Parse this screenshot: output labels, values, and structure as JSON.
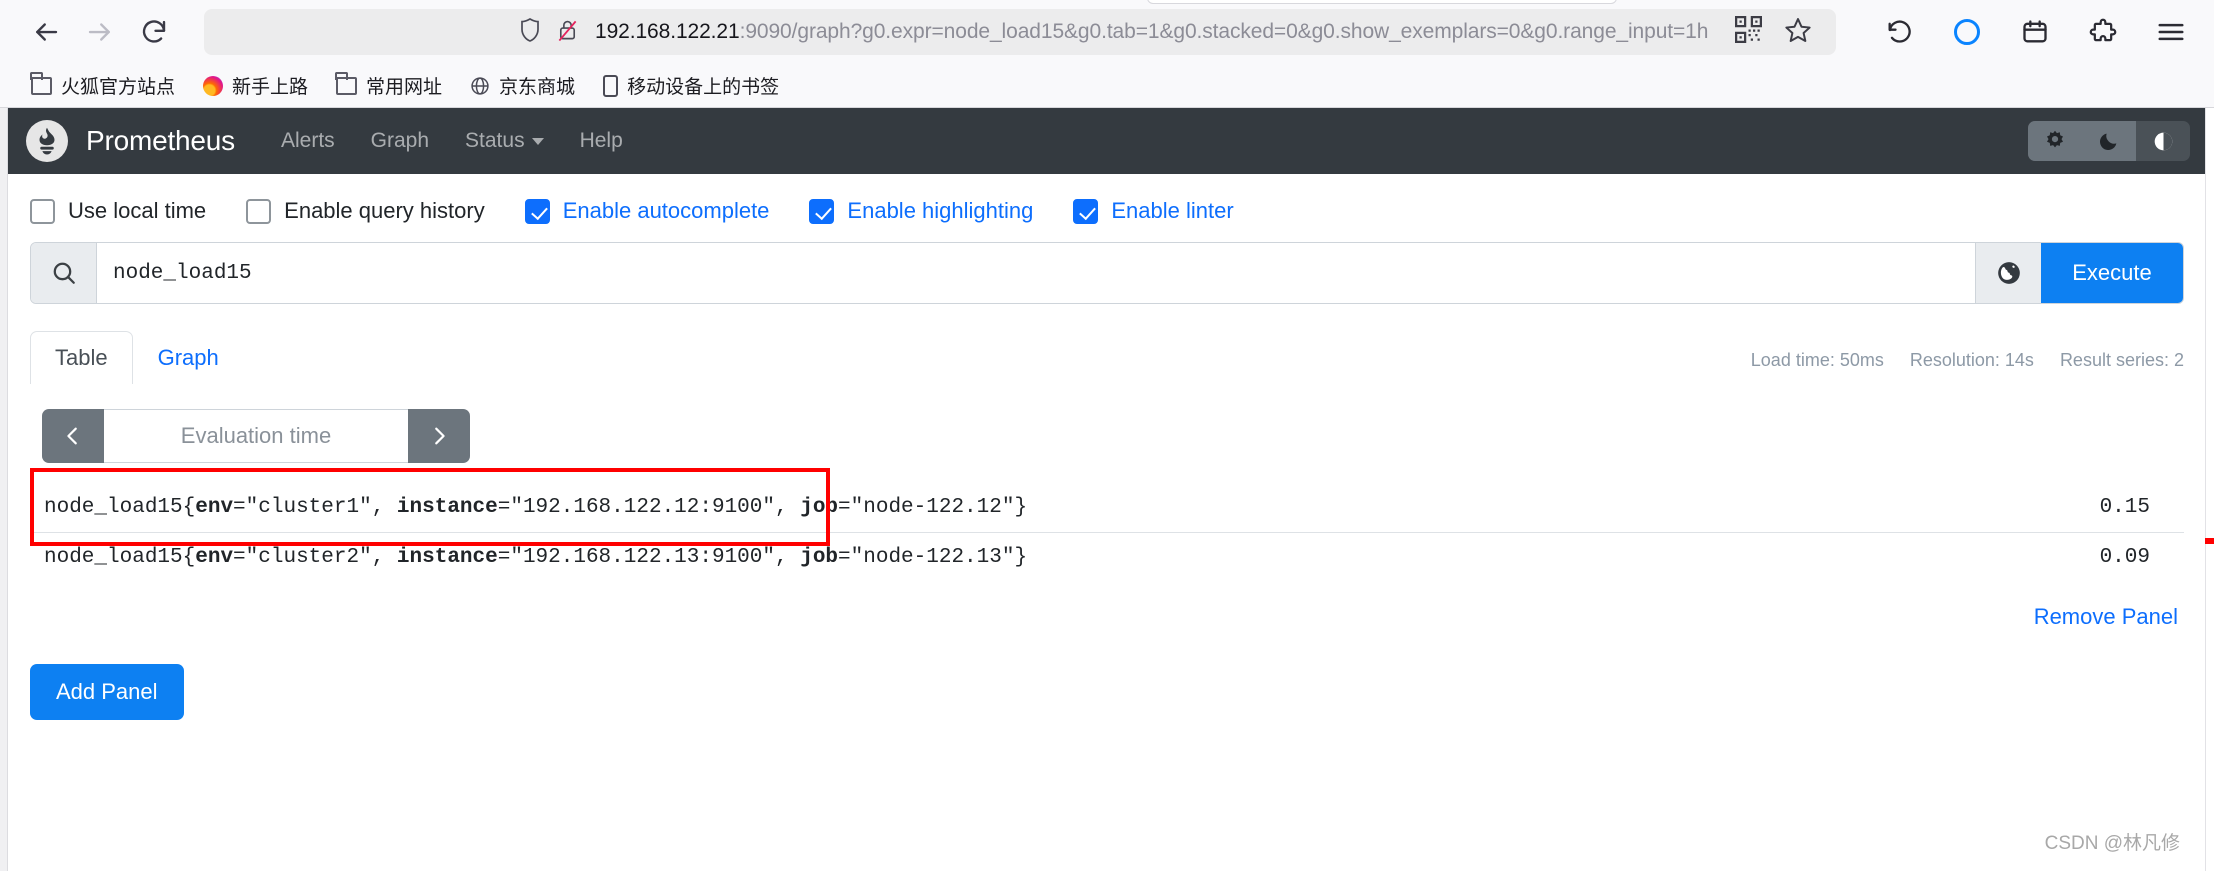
{
  "browser": {
    "back_icon": "back-arrow-icon",
    "forward_icon": "forward-arrow-icon",
    "reload_icon": "reload-icon",
    "shield_icon": "shield-icon",
    "no_permission_icon": "permission-blocked-icon",
    "url_host": "192.168.122.21",
    "url_rest": ":9090/graph?g0.expr=node_load15&g0.tab=1&g0.stacked=0&g0.show_exemplars=0&g0.range_input=1h",
    "qr_icon": "qr-code-icon",
    "bookmark_star_icon": "star-icon",
    "undo_icon": "undo-arrow-icon",
    "account_icon": "account-circle-icon",
    "extension_icon": "extension-puzzle-icon",
    "save_to_pocket_icon": "save-page-icon",
    "menu_icon": "hamburger-menu-icon"
  },
  "bookmarks": [
    {
      "label": "火狐官方站点",
      "icon": "folder-icon"
    },
    {
      "label": "新手上路",
      "icon": "firefox-icon"
    },
    {
      "label": "常用网址",
      "icon": "folder-icon"
    },
    {
      "label": "京东商城",
      "icon": "globe-icon"
    }
  ],
  "bookmarks_mobile": {
    "label": "移动设备上的书签",
    "icon": "mobile-phone-icon"
  },
  "prometheus_nav": {
    "brand": "Prometheus",
    "logo_icon": "prometheus-logo-icon",
    "links": [
      {
        "label": "Alerts"
      },
      {
        "label": "Graph"
      },
      {
        "label": "Status",
        "dropdown": true
      },
      {
        "label": "Help"
      }
    ],
    "theme_buttons": [
      {
        "icon": "sun-icon",
        "name": "light-theme",
        "active": false
      },
      {
        "icon": "moon-icon",
        "name": "dark-theme",
        "active": false
      },
      {
        "icon": "half-circle-icon",
        "name": "auto-theme",
        "active": true
      }
    ]
  },
  "options": [
    {
      "label": "Use local time",
      "checked": false
    },
    {
      "label": "Enable query history",
      "checked": false
    },
    {
      "label": "Enable autocomplete",
      "checked": true
    },
    {
      "label": "Enable highlighting",
      "checked": true
    },
    {
      "label": "Enable linter",
      "checked": true
    }
  ],
  "query": {
    "search_icon": "search-icon",
    "value": "node_load15",
    "globe_icon": "globe-icon",
    "execute_label": "Execute"
  },
  "tabs": [
    {
      "label": "Table",
      "active": true
    },
    {
      "label": "Graph",
      "active": false
    }
  ],
  "stats": {
    "load_time": "Load time: 50ms",
    "resolution": "Resolution: 14s",
    "result_series": "Result series: 2"
  },
  "evaluation": {
    "prev_icon": "chevron-left-icon",
    "next_icon": "chevron-right-icon",
    "placeholder": "Evaluation time"
  },
  "results": {
    "rows": [
      {
        "metric": "node_load15",
        "labels": [
          {
            "name": "env",
            "value": "\"cluster1\""
          },
          {
            "name": "instance",
            "value": "\"192.168.122.12:9100\""
          },
          {
            "name": "job",
            "value": "\"node-122.12\""
          }
        ],
        "value": "0.15"
      },
      {
        "metric": "node_load15",
        "labels": [
          {
            "name": "env",
            "value": "\"cluster2\""
          },
          {
            "name": "instance",
            "value": "\"192.168.122.13:9100\""
          },
          {
            "name": "job",
            "value": "\"node-122.13\""
          }
        ],
        "value": "0.09"
      }
    ]
  },
  "remove_panel_label": "Remove Panel",
  "add_panel_label": "Add Panel",
  "watermark": "CSDN @林凡修",
  "colors": {
    "accent_blue": "#0d80f2",
    "link_blue": "#0d6efd",
    "navbar_dark": "#343a40",
    "annotation_red": "#ff0000"
  }
}
